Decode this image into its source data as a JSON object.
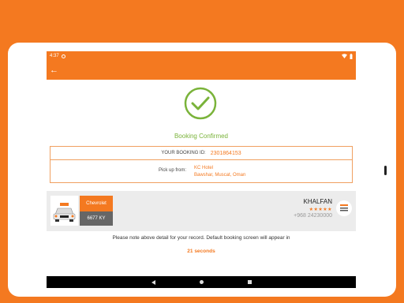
{
  "status_bar": {
    "time": "4:37"
  },
  "app_bar": {
    "back_icon": "←"
  },
  "booking": {
    "title": "Booking Confirmed",
    "id_label": "YOUR BOOKING ID:",
    "id_value": "2301864153",
    "pickup_label": "Pick up from:",
    "pickup_name": "KC Hotel",
    "pickup_address": "Bawshar, Muscat, Oman"
  },
  "driver": {
    "car_model": "Chevrolet",
    "plate": "6677 KY",
    "name": "KHALFAN",
    "stars": "★★★★★",
    "phone": "+968 24230000"
  },
  "note": {
    "text": "Please note above detail for your record. Default booking screen will appear in",
    "countdown": "21 seconds"
  },
  "colors": {
    "accent": "#f47920",
    "success": "#7ab33a"
  }
}
